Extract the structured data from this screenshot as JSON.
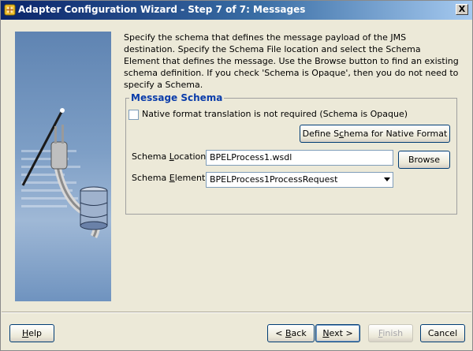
{
  "window": {
    "title": "Adapter Configuration Wizard - Step 7 of 7: Messages",
    "close_glyph": "X"
  },
  "description": "Specify the schema that defines the message payload of the JMS destination.  Specify the Schema File location and select the Schema Element that defines the message. Use the Browse button to find an existing schema definition. If you check 'Schema is Opaque', then you do not need to specify a Schema.",
  "message_schema": {
    "legend": "Message Schema",
    "opaque_checkbox": {
      "label": "Native format translation is not required (Schema is Opaque)",
      "checked": false
    },
    "define_button": {
      "label_pre": "Define S",
      "label_mn": "c",
      "label_post": "hema for Native Format"
    },
    "schema_location": {
      "label_pre": "Schema ",
      "label_mn": "L",
      "label_post": "ocation:",
      "value": "BPELProcess1.wsdl"
    },
    "browse_button": {
      "label": "Browse"
    },
    "schema_element": {
      "label_pre": "Schema ",
      "label_mn": "E",
      "label_post": "lement:",
      "value": "BPELProcess1ProcessRequest"
    }
  },
  "footer": {
    "help": {
      "label_mn": "H",
      "label_post": "elp"
    },
    "back": {
      "label_pre": "< ",
      "label_mn": "B",
      "label_post": "ack"
    },
    "next": {
      "label_mn": "N",
      "label_post": "ext >"
    },
    "finish": {
      "label_mn": "F",
      "label_post": "inish"
    },
    "cancel": {
      "label": "Cancel"
    }
  },
  "colors": {
    "title_start": "#0a246a",
    "title_end": "#a6caf0",
    "legend": "#0a3caa",
    "background": "#ece9d8"
  }
}
